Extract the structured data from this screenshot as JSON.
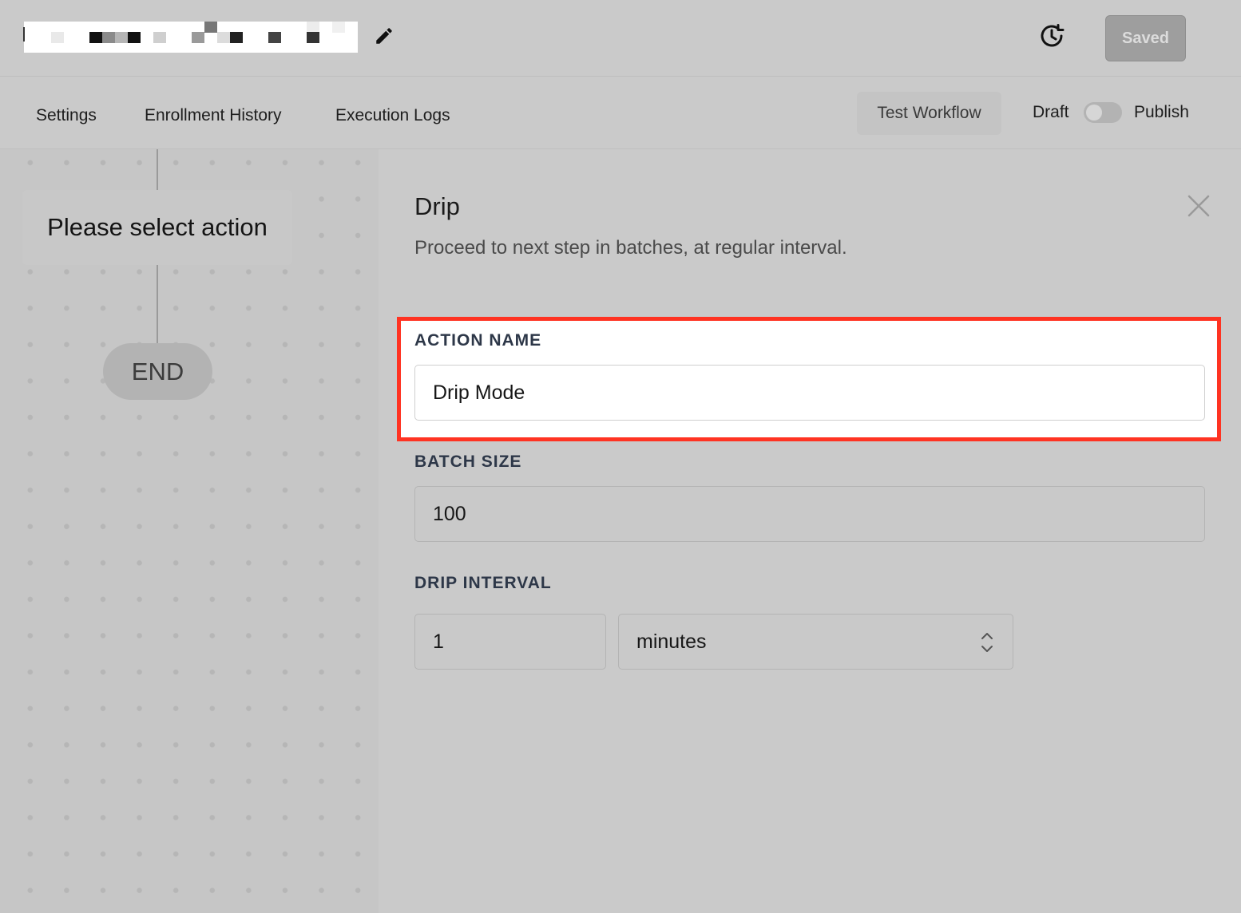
{
  "header": {
    "saved_label": "Saved"
  },
  "tabs": [
    {
      "label": "Settings"
    },
    {
      "label": "Enrollment History"
    },
    {
      "label": "Execution Logs"
    }
  ],
  "toolbar": {
    "test_workflow_label": "Test Workflow",
    "draft_label": "Draft",
    "publish_label": "Publish",
    "publish_toggle_on": false
  },
  "canvas": {
    "action_node_label": "Please select action",
    "end_node_label": "END"
  },
  "panel": {
    "title": "Drip",
    "description": "Proceed to next step in batches, at regular interval.",
    "fields": {
      "action_name": {
        "label": "ACTION NAME",
        "value": "Drip Mode"
      },
      "batch_size": {
        "label": "BATCH SIZE",
        "value": "100"
      },
      "drip_interval": {
        "label": "DRIP INTERVAL",
        "value": "1",
        "unit": "minutes"
      }
    }
  },
  "colors": {
    "highlight_border": "#ff3322",
    "overlay_gray": "#cacaca"
  }
}
